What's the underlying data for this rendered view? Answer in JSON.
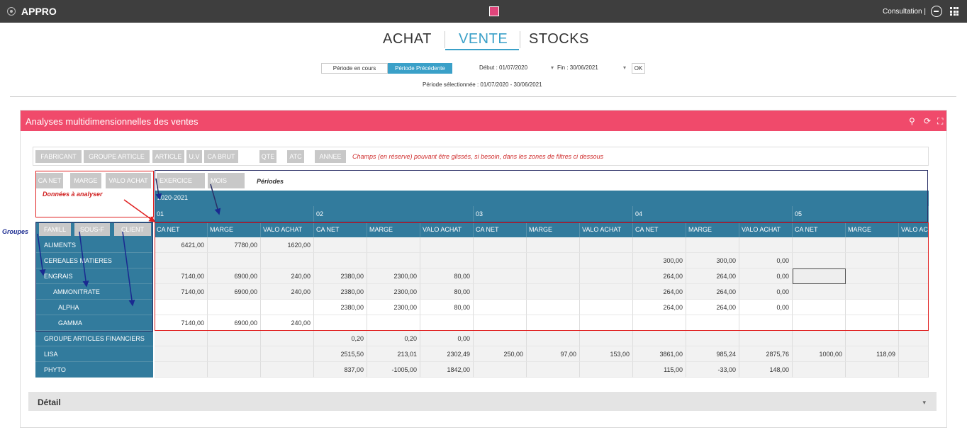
{
  "topbar": {
    "app_title": "APPRO",
    "mode": "Consultation |"
  },
  "tabs": [
    "ACHAT",
    "VENTE",
    "STOCKS"
  ],
  "period": {
    "btn_current": "Période en cours",
    "btn_previous": "Période Précédente",
    "start_label": "Début : 01/07/2020",
    "end_label": "Fin : 30/06/2021",
    "ok": "OK",
    "selected": "Période sélectionnée : 01/07/2020 - 30/06/2021"
  },
  "panel": {
    "title": "Analyses multidimensionnelles des ventes",
    "reserve_fields": [
      "FABRICANT",
      "GROUPE ARTICLE",
      "ARTICLE",
      "U.V",
      "CA BRUT",
      "QTE",
      "ATC",
      "ANNEE"
    ],
    "reserve_note": "Champs (en réserve) pouvant être glissés, si besoin, dans les zones de filtres ci dessous",
    "data_fields": [
      "CA NET",
      "MARGE",
      "VALO ACHAT"
    ],
    "column_fields": [
      "EXERCICE",
      "MOIS"
    ],
    "row_fields": [
      "FAMILL",
      "SOUS-F",
      "CLIENT"
    ]
  },
  "annotations": {
    "data": "Données à analyser",
    "periods": "Périodes",
    "groups": "Groupes"
  },
  "pivot": {
    "year": "2020-2021",
    "months": [
      "01",
      "02",
      "03",
      "04",
      "05"
    ],
    "measures": [
      "CA NET",
      "MARGE",
      "VALO ACHAT",
      "CA NET",
      "MARGE",
      "VALO ACHAT",
      "CA NET",
      "MARGE",
      "VALO ACHAT",
      "CA NET",
      "MARGE",
      "VALO ACHAT",
      "CA NET",
      "MARGE",
      "VALO AC"
    ],
    "rows": [
      {
        "label": "ALIMENTS",
        "cells": [
          "6421,00",
          "7780,00",
          "1620,00",
          "",
          "",
          "",
          "",
          "",
          "",
          "",
          "",
          "",
          "",
          "",
          ""
        ]
      },
      {
        "label": "CEREALES MATIERES",
        "cells": [
          "",
          "",
          "",
          "",
          "",
          "",
          "",
          "",
          "",
          "300,00",
          "300,00",
          "0,00",
          "",
          "",
          ""
        ]
      },
      {
        "label": "ENGRAIS",
        "cells": [
          "7140,00",
          "6900,00",
          "240,00",
          "2380,00",
          "2300,00",
          "80,00",
          "",
          "",
          "",
          "264,00",
          "264,00",
          "0,00",
          "",
          "",
          ""
        ]
      },
      {
        "label": "AMMONITRATE",
        "cells": [
          "7140,00",
          "6900,00",
          "240,00",
          "2380,00",
          "2300,00",
          "80,00",
          "",
          "",
          "",
          "264,00",
          "264,00",
          "0,00",
          "",
          "",
          ""
        ]
      },
      {
        "label": "ALPHA",
        "cells": [
          "",
          "",
          "",
          "2380,00",
          "2300,00",
          "80,00",
          "",
          "",
          "",
          "264,00",
          "264,00",
          "0,00",
          "",
          "",
          ""
        ]
      },
      {
        "label": "GAMMA",
        "cells": [
          "7140,00",
          "6900,00",
          "240,00",
          "",
          "",
          "",
          "",
          "",
          "",
          "",
          "",
          "",
          "",
          "",
          ""
        ]
      },
      {
        "label": "GROUPE ARTICLES FINANCIERS",
        "cells": [
          "",
          "",
          "",
          "0,20",
          "0,20",
          "0,00",
          "",
          "",
          "",
          "",
          "",
          "",
          "",
          "",
          ""
        ]
      },
      {
        "label": "LISA",
        "cells": [
          "",
          "",
          "",
          "2515,50",
          "213,01",
          "2302,49",
          "250,00",
          "97,00",
          "153,00",
          "3861,00",
          "985,24",
          "2875,76",
          "1000,00",
          "118,09",
          ""
        ]
      },
      {
        "label": "PHYTO",
        "cells": [
          "",
          "",
          "",
          "837,00",
          "-1005,00",
          "1842,00",
          "",
          "",
          "",
          "115,00",
          "-33,00",
          "148,00",
          "",
          "",
          ""
        ]
      }
    ]
  },
  "detail": {
    "title": "Détail"
  },
  "colors": {
    "accent": "#f04a6b",
    "pivot_blue": "#327b9d",
    "tab_active": "#3aa0c8"
  }
}
